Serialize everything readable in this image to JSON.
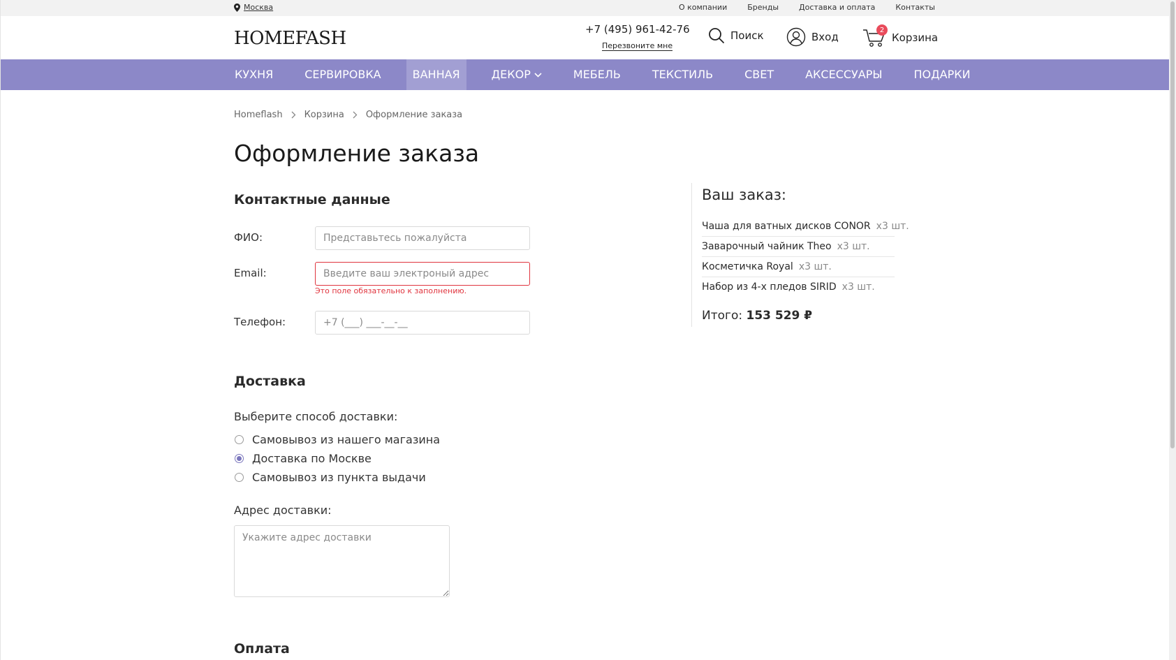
{
  "topbar": {
    "city": "Москва",
    "links": [
      "О компании",
      "Бренды",
      "Доставка и оплата",
      "Контакты"
    ]
  },
  "header": {
    "logo": "HOMEFASH",
    "phone": "+7 (495) 961-42-76",
    "callback": "Перезвоните мне",
    "search": "Поиск",
    "login": "Вход",
    "cart": "Корзина",
    "cart_count": "2"
  },
  "nav": {
    "items": [
      "КУХНЯ",
      "СЕРВИРОВКА",
      "ВАННАЯ",
      "ДЕКОР",
      "МЕБЕЛЬ",
      "ТЕКСТИЛЬ",
      "СВЕТ",
      "АКСЕССУАРЫ",
      "ПОДАРКИ"
    ],
    "active_index": 2
  },
  "breadcrumb": [
    "Homeflash",
    "Корзина",
    "Оформление заказа"
  ],
  "page_title": "Оформление заказа",
  "contacts": {
    "heading": "Контактные данные",
    "name_label": "ФИО:",
    "name_placeholder": "Представьтесь пожалуйста",
    "email_label": "Email:",
    "email_placeholder": "Введите ваш электроный адрес",
    "email_error": "Это поле обязательно к заполнению.",
    "phone_label": "Телефон:",
    "phone_placeholder": "+7 (___) ___-__-__"
  },
  "delivery": {
    "heading": "Доставка",
    "question": "Выберите способ доставки:",
    "options": [
      "Самовывоз из нашего магазина",
      "Доставка по Москве",
      "Самовывоз из пункта выдачи"
    ],
    "selected_index": 1,
    "address_label": "Адрес доставки:",
    "address_placeholder": "Укажите адрес доставки"
  },
  "payment": {
    "heading": "Оплата"
  },
  "order": {
    "heading": "Ваш заказ:",
    "items": [
      {
        "name": "Чаша для ватных дисков CONOR",
        "qty": "x3 шт."
      },
      {
        "name": "Заварочный чайник Theo",
        "qty": "x3 шт."
      },
      {
        "name": "Косметичка Royal",
        "qty": "x3 шт."
      },
      {
        "name": "Набор из 4-х пледов SIRID",
        "qty": "x3 шт."
      }
    ],
    "total_label": "Итого:",
    "total_value": "153 529 ₽"
  },
  "colors": {
    "nav_bg": "#8c88c8",
    "nav_active": "#a29fd3",
    "error": "#e0343e",
    "badge": "#e94b5b"
  }
}
